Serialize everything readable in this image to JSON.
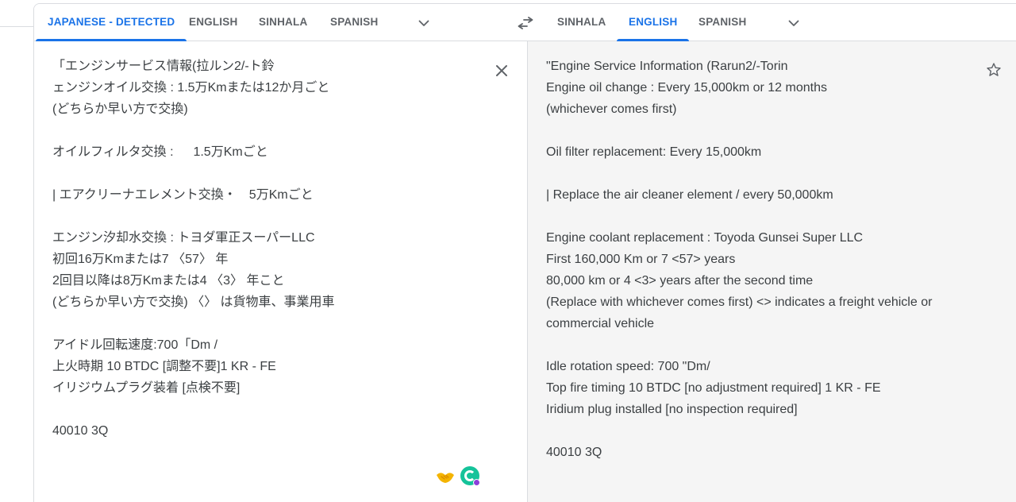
{
  "source_langs": {
    "tabs": [
      "JAPANESE - DETECTED",
      "ENGLISH",
      "SINHALA",
      "SPANISH"
    ],
    "active": 0
  },
  "target_langs": {
    "tabs": [
      "SINHALA",
      "ENGLISH",
      "SPANISH"
    ],
    "active": 1
  },
  "icons": {
    "source_more": "chevron-down-icon",
    "target_more": "chevron-down-icon",
    "swap": "swap-languages-icon",
    "clear": "close-icon",
    "save": "star-icon",
    "ext1": "handshake-icon",
    "ext2": "grammarly-icon"
  },
  "source": {
    "text": "「エンジンサービス情報(拉ルン2/-ト鈴\nェンジンオイル交換 : 1.5万Kmまたは12か月ごと\n(どちらか早い方で交換)\n\nオイルフィルタ交換 :　  1.5万Kmごと\n\n| エアクリーナエレメント交換・　5万Kmごと\n\nエンジン汐却水交換 : トヨダ軍正スーパーLLC\n初回16万Kmまたは7 〈57〉 年\n2回目以降は8万Kmまたは4 〈3〉 年こと\n(どちらか早い方で交換) 〈〉 は貨物車、事業用車\n\nアイドル回転速度:700「Dm /\n上火時期 10 BTDC [調整不要]1 KR - FE\nイリジウムプラグ装着 [点検不要]\n\n40010 3Q"
  },
  "target": {
    "text": "\"Engine Service Information (Rarun2/-Torin\nEngine oil change : Every 15,000km or 12 months\n(whichever comes first)\n\nOil filter replacement: Every 15,000km\n\n| Replace the air cleaner element / every 50,000km\n\nEngine coolant replacement : Toyoda Gunsei Super LLC\nFirst 160,000 Km or 7 <57> years\n80,000 km or 4 <3> years after the second time\n(Replace with whichever comes first) <> indicates a freight vehicle or commercial vehicle\n\nIdle rotation speed: 700 \"Dm/\nTop fire timing 10 BTDC [no adjustment required] 1 KR - FE\nIridium plug installed [no inspection required]\n\n40010 3Q"
  },
  "colors": {
    "accent": "#1a73e8",
    "tab_text": "#5f6368",
    "body_text": "#3c4043",
    "target_bg": "#f5f5f5",
    "border": "#dadce0"
  }
}
